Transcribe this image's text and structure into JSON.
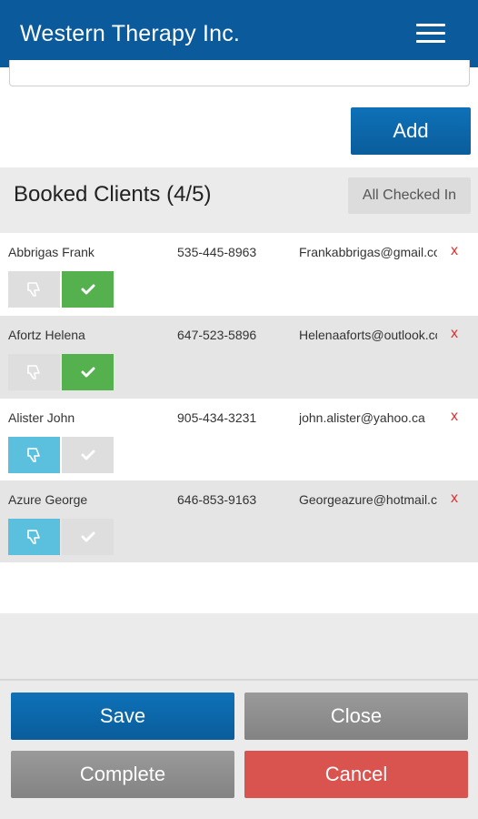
{
  "app": {
    "title": "Western Therapy Inc."
  },
  "actions": {
    "add_label": "Add"
  },
  "booked": {
    "title": "Booked Clients (4/5)",
    "all_checked_in_label": "All Checked In"
  },
  "clients": [
    {
      "name": "Abbrigas Frank",
      "phone": "535-445-8963",
      "email": "Frankabbrigas@gmail.com",
      "remove": "x",
      "no_show": false,
      "checked_in": true
    },
    {
      "name": "Afortz Helena",
      "phone": "647-523-5896",
      "email": "Helenaaforts@outlook.com",
      "remove": "x",
      "no_show": false,
      "checked_in": true
    },
    {
      "name": "Alister John",
      "phone": "905-434-3231",
      "email": "john.alister@yahoo.ca",
      "remove": "x",
      "no_show": true,
      "checked_in": false
    },
    {
      "name": "Azure George",
      "phone": "646-853-9163",
      "email": "Georgeazure@hotmail.com",
      "remove": "x",
      "no_show": true,
      "checked_in": false
    }
  ],
  "icons": {
    "menu": "hamburger-menu-icon",
    "no_show": "thumbs-down-icon",
    "check_in": "checkmark-icon",
    "remove": "close-x-icon"
  },
  "footer": {
    "save_label": "Save",
    "close_label": "Close",
    "complete_label": "Complete",
    "cancel_label": "Cancel"
  },
  "colors": {
    "header": "#0a5a9c",
    "primary": "#0e71b8",
    "checked_in": "#55b04e",
    "no_show": "#5bc0de",
    "danger": "#d9534f",
    "remove_x": "#e32b2b"
  }
}
